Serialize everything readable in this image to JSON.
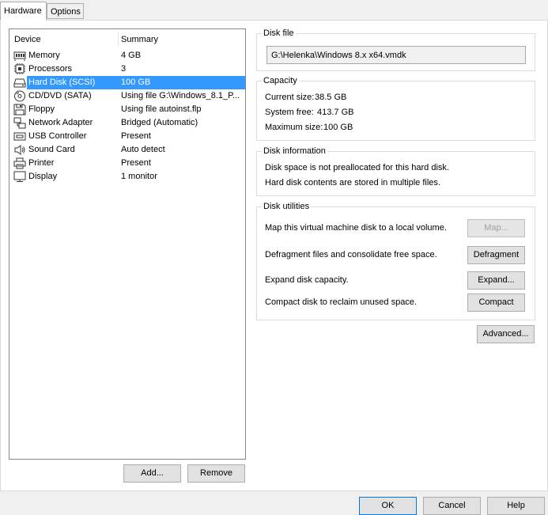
{
  "tabs": [
    {
      "label": "Hardware",
      "active": true
    },
    {
      "label": "Options",
      "active": false
    }
  ],
  "device_list": {
    "columns": {
      "device": "Device",
      "summary": "Summary"
    },
    "items": [
      {
        "icon": "memory-icon",
        "name": "Memory",
        "summary": "4 GB"
      },
      {
        "icon": "processor-icon",
        "name": "Processors",
        "summary": "3"
      },
      {
        "icon": "hard-disk-icon",
        "name": "Hard Disk (SCSI)",
        "summary": "100 GB",
        "selected": true
      },
      {
        "icon": "cd-dvd-icon",
        "name": "CD/DVD (SATA)",
        "summary": "Using file G:\\Windows_8.1_P..."
      },
      {
        "icon": "floppy-icon",
        "name": "Floppy",
        "summary": "Using file autoinst.flp"
      },
      {
        "icon": "network-adapter-icon",
        "name": "Network Adapter",
        "summary": "Bridged (Automatic)"
      },
      {
        "icon": "usb-icon",
        "name": "USB Controller",
        "summary": "Present"
      },
      {
        "icon": "sound-card-icon",
        "name": "Sound Card",
        "summary": "Auto detect"
      },
      {
        "icon": "printer-icon",
        "name": "Printer",
        "summary": "Present"
      },
      {
        "icon": "display-icon",
        "name": "Display",
        "summary": "1 monitor"
      }
    ],
    "add_label": "Add...",
    "remove_label": "Remove"
  },
  "disk_file": {
    "title": "Disk file",
    "value": "G:\\Helenka\\Windows 8.x x64.vmdk"
  },
  "capacity": {
    "title": "Capacity",
    "current_label": "Current size:",
    "current_value": "38.5 GB",
    "free_label": "System free:",
    "free_value": "413.7 GB",
    "max_label": "Maximum size:",
    "max_value": "100 GB"
  },
  "disk_information": {
    "title": "Disk information",
    "line1": "Disk space is not preallocated for this hard disk.",
    "line2": "Hard disk contents are stored in multiple files."
  },
  "disk_utilities": {
    "title": "Disk utilities",
    "map_text": "Map this virtual machine disk to a local volume.",
    "map_button": "Map...",
    "defrag_text": "Defragment files and consolidate free space.",
    "defrag_button": "Defragment",
    "expand_text": "Expand disk capacity.",
    "expand_button": "Expand...",
    "compact_text": "Compact disk to reclaim unused space.",
    "compact_button": "Compact"
  },
  "advanced_label": "Advanced...",
  "footer": {
    "ok": "OK",
    "cancel": "Cancel",
    "help": "Help"
  },
  "colors": {
    "selection": "#3399ff",
    "default_button_border": "#0078d7"
  }
}
